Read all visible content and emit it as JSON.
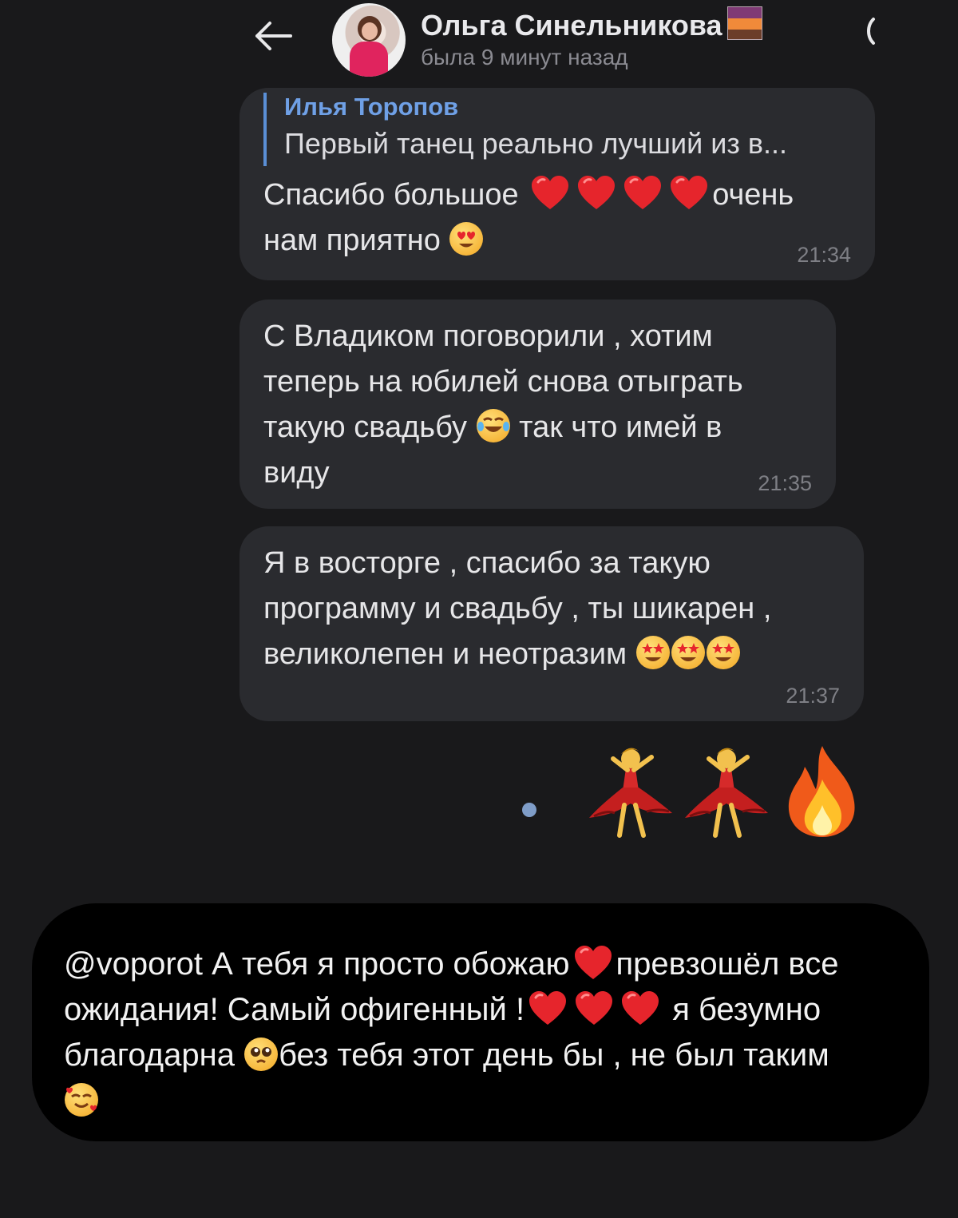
{
  "header": {
    "back_icon": "arrow-left-icon",
    "avatar_icon": "profile-avatar",
    "contact_name": "Ольга Синельникова",
    "name_emoji_icon": "sunset-icon",
    "status": "была 9 минут назад",
    "call_icon": "phone-icon"
  },
  "messages": [
    {
      "reply_author": "Илья Торопов",
      "reply_text": "Первый танец реально лучший из в...",
      "text_part1": "Спасибо большое",
      "text_part2": "очень",
      "text_part3": "нам приятно",
      "time": "21:34"
    },
    {
      "line1": "С Владиком поговорили , хотим",
      "line2": "теперь на юбилей снова отыграть",
      "line3a": "такую свадьбу",
      "line3b": "так что имей в",
      "line4": "виду",
      "time": "21:35"
    },
    {
      "line1": "Я в восторге , спасибо за такую",
      "line2": "программу и свадьбу , ты шикарен ,",
      "line3": "великолепен и неотразим",
      "time": "21:37"
    }
  ],
  "emoji_row": [
    "dancer-icon",
    "dancer-icon",
    "fire-icon"
  ],
  "overlay": {
    "line1a": "@voporot А тебя я просто обожаю",
    "line1b": "превзошёл все",
    "line2a": "ожидания! Самый офигенный !",
    "line2b": "я безумно",
    "line3a": "благодарна",
    "line3b": "без тебя этот день бы , не был таким"
  },
  "colors": {
    "background": "#19191b",
    "bubble": "#2a2b2f",
    "accent": "#6fa0e6",
    "overlay": "#000000"
  }
}
